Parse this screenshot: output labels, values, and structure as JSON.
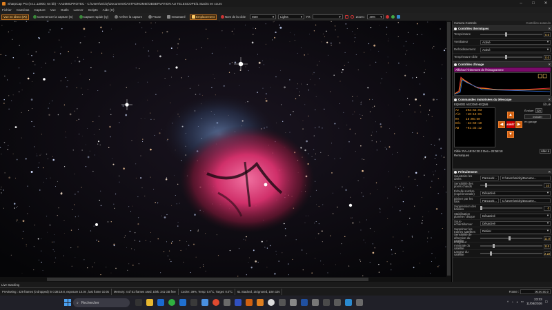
{
  "window": {
    "title": "SharpCap Pro (v4.1.13000, 64 bit) - AA26MCPROTEC - C:\\Users\\micky\\Documents\\ASTRONOMIE\\OBSERVATION AU TELESCOPE\\1 Stacks en cours",
    "controls": [
      "–",
      "□",
      "✕"
    ]
  },
  "menu": [
    "Fichier",
    "Caméras",
    "Capture",
    "Vue",
    "Outils",
    "Lancer",
    "Scripts",
    "Aide (H)"
  ],
  "toolbar": {
    "live_view": "Vue en direct (W)",
    "start_capture": "Commencer la capture (S)",
    "quick_capture": "Capture rapide (Q)",
    "stop_capture": "Arrêter la capture",
    "pause": "Pause",
    "snapshot": "Instantané",
    "framing": "Emplacement",
    "target_name_label": "Nom de la cible",
    "target_name": "M20",
    "mode": "Lights",
    "fx_label": "FX",
    "zoom_label": "Zoom :",
    "zoom": "40%"
  },
  "panel": {
    "header": "Camera Controls",
    "advanced": "Contrôles avancés",
    "thermal": {
      "title": "Contrôles thermiques",
      "temp_label": "Température",
      "temp_value": "0.0",
      "fan_label": "Ventilateur",
      "fan_value": "Activé",
      "cooler_label": "Refroidissement",
      "cooler_value": "Activé",
      "target_label": "Température cible",
      "target_value": "0.0"
    },
    "image": {
      "title": "Contrôles d'image",
      "histogram_title": "Affichez l'étirement de l'histogramme"
    },
    "telescope": {
      "title": "Commandes motorisées du télescope",
      "mount": "EQMOD ASCOM HEQ5/6",
      "track_label": "Lié",
      "readout": [
        {
          "k": "Az",
          "v": "202:52:03"
        },
        {
          "k": "Alt",
          "v": "+10:13:01"
        },
        {
          "k": "RA",
          "v": "18:06:50"
        },
        {
          "k": "Déc",
          "v": "-22:59:10"
        },
        {
          "k": "AB",
          "v": "+01:33:12"
        }
      ],
      "stop": "ARRÊT",
      "speed_label": "Évaluer",
      "speed_value": "32x",
      "install": "Installer",
      "park": "en garage",
      "target_line": "Cible: RA=18:04:20.2 Dec=-22:58:18",
      "goto": "Aller à",
      "remarks": "Remarques"
    },
    "preprocess": {
      "title": "Prétraitement",
      "rows": [
        {
          "label": "Soustraire les darks",
          "button": "Parcourir...",
          "value": "C:\\Users\\micky\\Docume..."
        },
        {
          "label": "Sensibilité des pixels chauds",
          "value": "10"
        },
        {
          "label": "Échelle sombre (expérimentale)",
          "dropdown": "Désactivé"
        },
        {
          "label": "Diviser par les flats",
          "button": "Parcourir...",
          "value": "C:\\Users\\micky\\Docume..."
        },
        {
          "label": "Suppression des bandes",
          "value": "0"
        },
        {
          "label": "Stabilisation planète / disque",
          "dropdown": "Désactivé"
        },
        {
          "label": "Sous-échantillonner",
          "dropdown": "Désactivé"
        },
        {
          "label": "Supprimer les trames satellites",
          "dropdown": "Retirer"
        },
        {
          "label": "Sensibilité de détection du satellite",
          "value": "11.0"
        },
        {
          "label": "Longueur minimale du satellite",
          "value": "115"
        },
        {
          "label": "Largeur du satellite",
          "value": "2.22"
        }
      ]
    }
  },
  "status": {
    "live_stacking": "Live Stacking",
    "cells": [
      "Previewing : 429 frames (0 dropped) in 0:38:19.8, exposure 10.0s , last frame 10.0s",
      "Memory: 4 of 51 frames used, Disk: 341 GB free",
      "Cooler: 39%, Temp: 0.0°C, Target: 0.0°C",
      "61 Stacked, 15 ignored, 10m 10s"
    ],
    "frame_label": "Frame :",
    "time": "00:00:00.0"
  },
  "taskbar": {
    "search_placeholder": "Rechercher",
    "clock_time": "23:33",
    "clock_date": "11/08/2026"
  },
  "colors": {
    "accent": "#e08020",
    "section_purple": "#7a0a6a",
    "nebula_pink": "#d0306a",
    "nebula_blue": "#4a6a9a"
  }
}
